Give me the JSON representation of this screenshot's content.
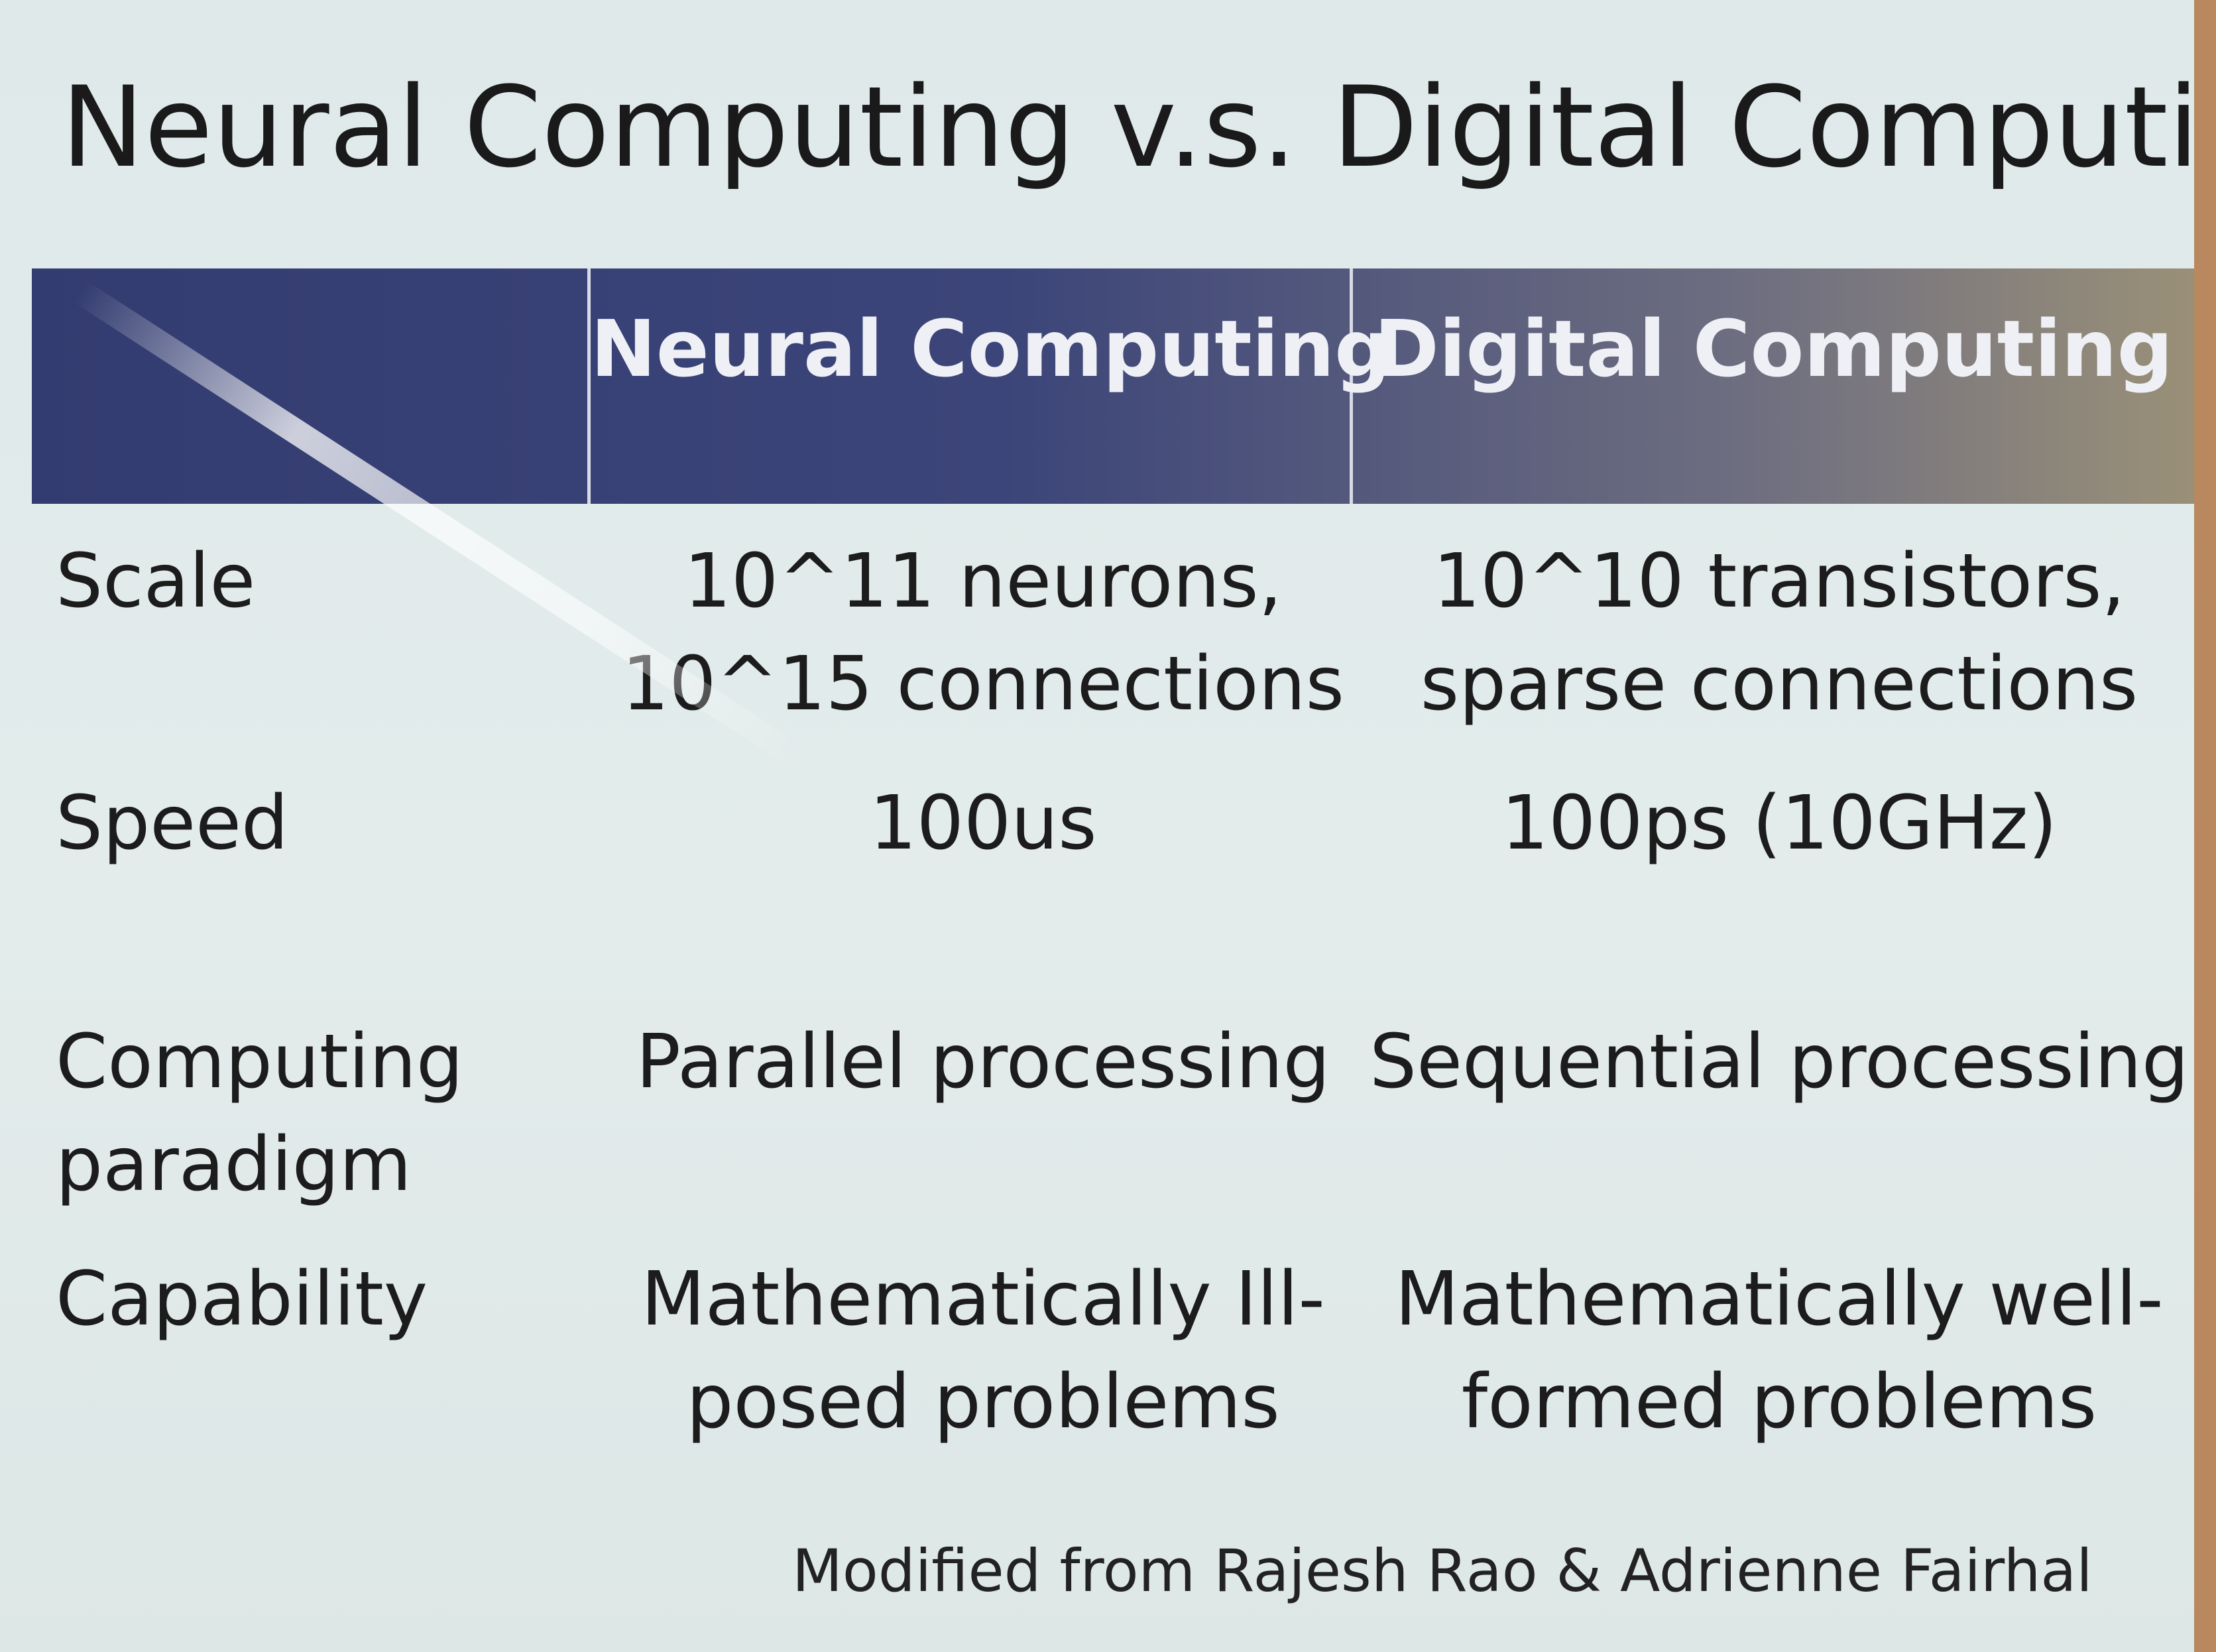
{
  "slide": {
    "title": "Neural Computing v.s. Digital Computing",
    "credit": "Modified from Rajesh Rao & Adrienne Fairhal"
  },
  "table": {
    "headers": [
      "Neural Computing",
      "Digital Computing"
    ],
    "rows": [
      {
        "label": [
          "Scale"
        ],
        "neural": [
          "10^11 neurons,",
          "10^15 connections"
        ],
        "digital": [
          "10^10 transistors,",
          "sparse connections"
        ]
      },
      {
        "label": [
          "Speed"
        ],
        "neural": [
          "100us"
        ],
        "digital": [
          "100ps (10GHz)"
        ]
      },
      {
        "label": [
          "Computing",
          "paradigm"
        ],
        "neural": [
          "Parallel processing"
        ],
        "digital": [
          "Sequential processing"
        ]
      },
      {
        "label": [
          "Capability"
        ],
        "neural": [
          "Mathematically Ill-",
          "posed problems"
        ],
        "digital": [
          "Mathematically well-",
          "formed problems"
        ]
      }
    ]
  }
}
